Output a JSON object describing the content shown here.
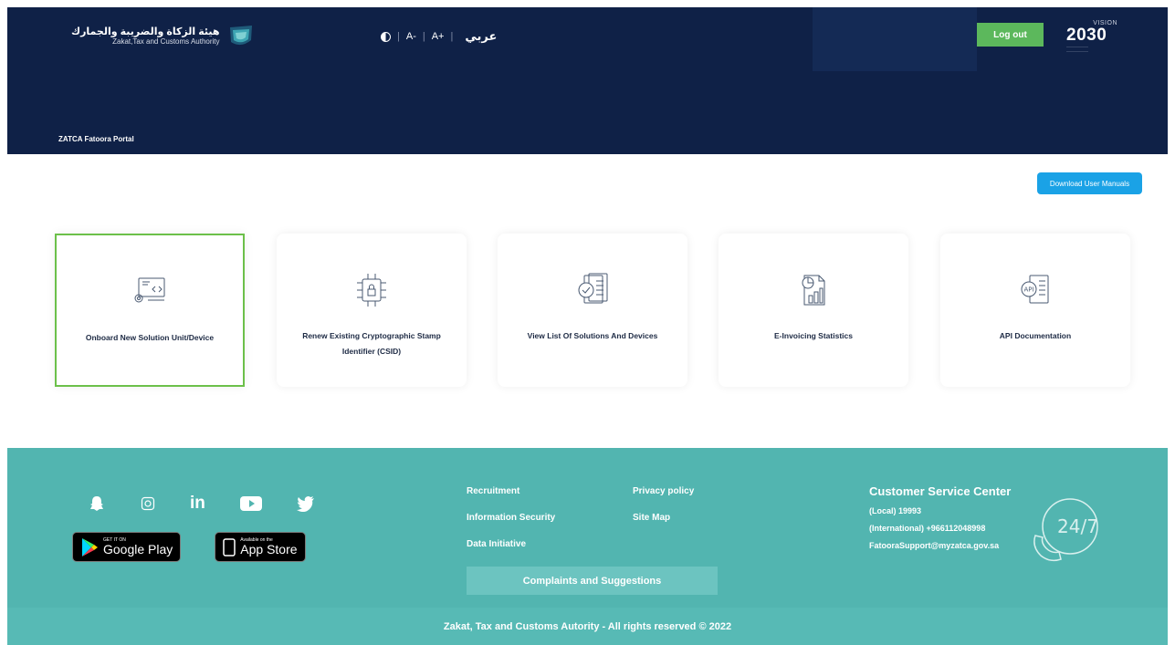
{
  "header": {
    "logo_ar": "هيئة الزكاة والضريبة والجمارك",
    "logo_en": "Zakat,Tax and Customs Authority",
    "a11y": {
      "decrease_font": "A-",
      "increase_font": "A+",
      "language": "عربي"
    },
    "logout_label": "Log out",
    "vision": {
      "top": "VISION",
      "year": "2030"
    },
    "portal_title": "ZATCA Fatoora Portal"
  },
  "main": {
    "manuals_label": "Download User Manuals",
    "cards": [
      {
        "label": "Onboard New Solution Unit/Device",
        "icon": "computer-settings-icon"
      },
      {
        "label": "Renew Existing Cryptographic Stamp Identifier (CSID)",
        "icon": "chip-lock-icon"
      },
      {
        "label": "View List Of Solutions And Devices",
        "icon": "document-check-icon"
      },
      {
        "label": "E-Invoicing Statistics",
        "icon": "statistics-report-icon"
      },
      {
        "label": "API Documentation",
        "icon": "api-document-icon"
      }
    ]
  },
  "footer": {
    "social": [
      "snapchat-icon",
      "instagram-icon",
      "linkedin-icon",
      "youtube-icon",
      "twitter-icon"
    ],
    "google_play": {
      "small": "GET IT ON",
      "big": "Google Play"
    },
    "app_store": {
      "small": "Available on the",
      "big": "App Store"
    },
    "links": {
      "recruitment": "Recruitment",
      "privacy": "Privacy policy",
      "info_security": "Information Security",
      "site_map": "Site Map",
      "data_initiative": "Data Initiative"
    },
    "complaints_label": "Complaints and Suggestions",
    "customer_service": {
      "title": "Customer Service Center",
      "local": "(Local) 19993",
      "international": "(International) +966112048998",
      "email": "FatooraSupport@myzatca.gov.sa",
      "badge": "24/7"
    },
    "copyright": "Zakat, Tax and Customs Autority - All rights reserved © 2022"
  },
  "colors": {
    "header_bg": "#0f2147",
    "accent_green": "#5cb85c",
    "manuals_blue": "#1aa2e6",
    "footer_teal": "#52b5b0",
    "active_card_border": "#6cc04a"
  }
}
